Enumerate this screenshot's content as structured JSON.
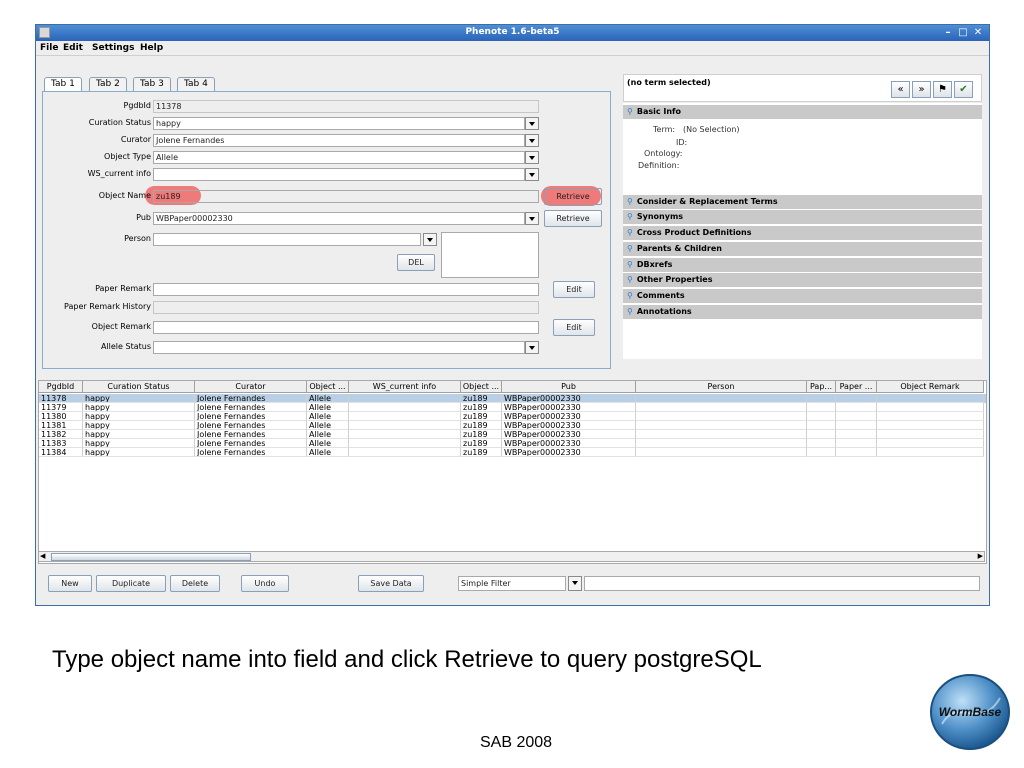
{
  "window": {
    "title": "Phenote 1.6-beta5"
  },
  "menu": {
    "items": [
      "File",
      "Edit",
      "Settings",
      "Help"
    ]
  },
  "tabs": [
    "Tab 1",
    "Tab 2",
    "Tab 3",
    "Tab 4"
  ],
  "form": {
    "pgdbid": {
      "label": "PgdbId",
      "value": "11378"
    },
    "curation_status": {
      "label": "Curation Status",
      "value": "happy"
    },
    "curator": {
      "label": "Curator",
      "value": "Jolene Fernandes"
    },
    "object_type": {
      "label": "Object Type",
      "value": "Allele"
    },
    "ws_current_info": {
      "label": "WS_current info",
      "value": ""
    },
    "object_name": {
      "label": "Object Name",
      "value": "zu189",
      "button": "Retrieve"
    },
    "pub": {
      "label": "Pub",
      "value": "WBPaper00002330",
      "button": "Retrieve"
    },
    "person": {
      "label": "Person",
      "value": "",
      "del_button": "DEL"
    },
    "paper_remark": {
      "label": "Paper Remark",
      "value": "",
      "button": "Edit"
    },
    "paper_remark_history": {
      "label": "Paper Remark History",
      "value": ""
    },
    "object_remark": {
      "label": "Object Remark",
      "value": "",
      "button": "Edit"
    },
    "allele_status": {
      "label": "Allele Status",
      "value": ""
    }
  },
  "term_panel": {
    "header": "(no term selected)",
    "basic_info": "Basic Info",
    "term_label": "Term:",
    "term_value": "(No Selection)",
    "id_label": "ID:",
    "ontology_label": "Ontology:",
    "definition_label": "Definition:",
    "sections": [
      "Consider & Replacement Terms",
      "Synonyms",
      "Cross Product Definitions",
      "Parents & Children",
      "DBxrefs",
      "Other Properties",
      "Comments",
      "Annotations"
    ],
    "icons": [
      "back-icon",
      "forward-icon",
      "flag-icon",
      "check-icon"
    ]
  },
  "table": {
    "columns": [
      "PgdbId",
      "Curation Status",
      "Curator",
      "Object ...",
      "WS_current info",
      "Object ...",
      "Pub",
      "Person",
      "Pap...",
      "Paper ...",
      "Object Remark"
    ],
    "rows": [
      [
        "11378",
        "happy",
        "Jolene Fernandes",
        "Allele",
        "",
        "zu189",
        "WBPaper00002330",
        "",
        "",
        "",
        ""
      ],
      [
        "11379",
        "happy",
        "Jolene Fernandes",
        "Allele",
        "",
        "zu189",
        "WBPaper00002330",
        "",
        "",
        "",
        ""
      ],
      [
        "11380",
        "happy",
        "Jolene Fernandes",
        "Allele",
        "",
        "zu189",
        "WBPaper00002330",
        "",
        "",
        "",
        ""
      ],
      [
        "11381",
        "happy",
        "Jolene Fernandes",
        "Allele",
        "",
        "zu189",
        "WBPaper00002330",
        "",
        "",
        "",
        ""
      ],
      [
        "11382",
        "happy",
        "Jolene Fernandes",
        "Allele",
        "",
        "zu189",
        "WBPaper00002330",
        "",
        "",
        "",
        ""
      ],
      [
        "11383",
        "happy",
        "Jolene Fernandes",
        "Allele",
        "",
        "zu189",
        "WBPaper00002330",
        "",
        "",
        "",
        ""
      ],
      [
        "11384",
        "happy",
        "Jolene Fernandes",
        "Allele",
        "",
        "zu189",
        "WBPaper00002330",
        "",
        "",
        "",
        ""
      ]
    ],
    "selected_row": 0
  },
  "toolbar": {
    "new": "New",
    "duplicate": "Duplicate",
    "delete": "Delete",
    "undo": "Undo",
    "save": "Save Data",
    "filter_value": "Simple Filter",
    "filter_text": ""
  },
  "caption": "Type object name into field and click Retrieve to query postgreSQL",
  "footer": "SAB 2008",
  "logo_text": "WormBase",
  "colors": {
    "titlebar": "#3a78c9",
    "highlight": "#f03c3c",
    "selected_row": "#b8cfe5"
  }
}
